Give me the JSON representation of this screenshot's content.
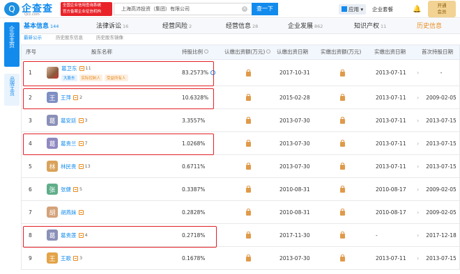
{
  "header": {
    "brand": "企查查",
    "brand_url": "Qcc.com",
    "slogan_line1": "全国企业信用查询系统",
    "slogan_line2": "官方备案企业征信机构",
    "search_value": "上海高沛投资（集团）有限公司",
    "search_button": "查一下",
    "apps_label": "应用",
    "enterprise_label": "企业套餐",
    "vip_line1": "开通",
    "vip_line2": "会员"
  },
  "rail": {
    "main_label": "企业主页",
    "sub_label": "品牌主页"
  },
  "tabs": [
    {
      "label": "基本信息",
      "count": "144"
    },
    {
      "label": "法律诉讼",
      "count": "16"
    },
    {
      "label": "经营风险",
      "count": "2"
    },
    {
      "label": "经营信息",
      "count": "28"
    },
    {
      "label": "企业发展",
      "count": "862"
    },
    {
      "label": "知识产权",
      "count": "11"
    },
    {
      "label": "历史信息",
      "count": ""
    }
  ],
  "subtabs": [
    "最新公示",
    "历史股东信息",
    "历史股东镜像"
  ],
  "table": {
    "headers": {
      "no": "序号",
      "holder": "股东名称",
      "ratio": "持股比例",
      "subscribed": "认缴出资额(万元)",
      "subscribed_date": "认缴出资日期",
      "paid": "实缴出资额(万元)",
      "paid_date": "实缴出资日期",
      "first_date": "首次持股日期"
    },
    "rows": [
      {
        "no": "1",
        "avatar": "",
        "name": "葛卫东",
        "count": "11",
        "ratio": "83.2573%",
        "sub_date": "2017-10-31",
        "paid_date": "2013-07-11",
        "first_date": "-",
        "tags": [
          "大股东",
          "实际控制人",
          "受益所有人"
        ],
        "color": ""
      },
      {
        "no": "2",
        "avatar": "王",
        "name": "王萍",
        "count": "2",
        "ratio": "10.6328%",
        "sub_date": "2015-02-28",
        "paid_date": "2013-07-11",
        "first_date": "2009-02-05",
        "tags": [],
        "color": "#7f8fc4"
      },
      {
        "no": "3",
        "avatar": "葛",
        "name": "葛安廷",
        "count": "3",
        "ratio": "3.3557%",
        "sub_date": "2013-07-30",
        "paid_date": "2013-07-11",
        "first_date": "2013-07-15",
        "tags": [],
        "color": "#8b90b8"
      },
      {
        "no": "4",
        "avatar": "葛",
        "name": "葛贵兰",
        "count": "7",
        "ratio": "1.0268%",
        "sub_date": "2013-07-30",
        "paid_date": "2013-07-11",
        "first_date": "2013-07-15",
        "tags": [],
        "color": "#8f89c0"
      },
      {
        "no": "5",
        "avatar": "林",
        "name": "林民贵",
        "count": "13",
        "ratio": "0.6711%",
        "sub_date": "2013-07-30",
        "paid_date": "2013-07-11",
        "first_date": "2013-07-15",
        "tags": [],
        "color": "#d9a25a"
      },
      {
        "no": "6",
        "avatar": "张",
        "name": "张健",
        "count": "5",
        "ratio": "0.3387%",
        "sub_date": "2010-08-31",
        "paid_date": "2010-08-17",
        "first_date": "2009-02-05",
        "tags": [],
        "color": "#5fae8a"
      },
      {
        "no": "7",
        "avatar": "胡",
        "name": "胡燕妹",
        "count": "",
        "ratio": "0.2828%",
        "sub_date": "2010-08-31",
        "paid_date": "2010-08-17",
        "first_date": "2009-02-05",
        "tags": [],
        "color": "#d4a27a"
      },
      {
        "no": "8",
        "avatar": "葛",
        "name": "葛贵莲",
        "count": "4",
        "ratio": "0.2718%",
        "sub_date": "2017-11-30",
        "paid_date": "-",
        "first_date": "2017-12-18",
        "tags": [],
        "color": "#8b90b8"
      },
      {
        "no": "9",
        "avatar": "王",
        "name": "王歌",
        "count": "3",
        "ratio": "0.1678%",
        "sub_date": "2013-07-30",
        "paid_date": "2013-07-11",
        "first_date": "2013-07-15",
        "tags": [],
        "color": "#e3a347"
      }
    ]
  }
}
